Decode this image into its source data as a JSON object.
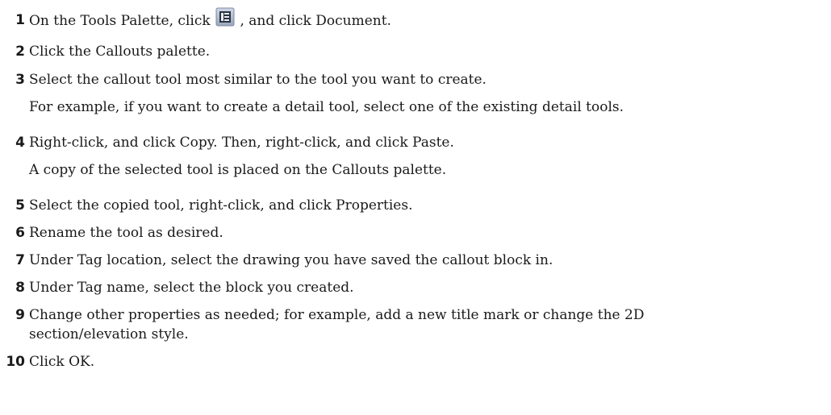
{
  "steps": [
    {
      "number": "1",
      "text_before": "On the Tools Palette, click ",
      "icon": "tool-palette-properties-icon",
      "text_after": " , and click Document."
    },
    {
      "number": "2",
      "text": "Click the Callouts palette."
    },
    {
      "number": "3",
      "text": "Select the callout tool most similar to the tool you want to create.",
      "note": "For example, if you want to create a detail tool, select one of the existing detail tools."
    },
    {
      "number": "4",
      "text": "Right-click, and click Copy. Then, right-click, and click Paste.",
      "note": "A copy of the selected tool is placed on the Callouts palette."
    },
    {
      "number": "5",
      "text": "Select the copied tool, right-click, and click Properties."
    },
    {
      "number": "6",
      "text": "Rename the tool as desired."
    },
    {
      "number": "7",
      "text": "Under Tag location, select the drawing you have saved the callout block in."
    },
    {
      "number": "8",
      "text": "Under Tag name, select the block you created."
    },
    {
      "number": "9",
      "text_line1": "Change other properties as needed; for example, add a new title mark or change the 2D",
      "text_line2": "section/elevation style."
    },
    {
      "number": "10",
      "text": "Click OK."
    }
  ]
}
